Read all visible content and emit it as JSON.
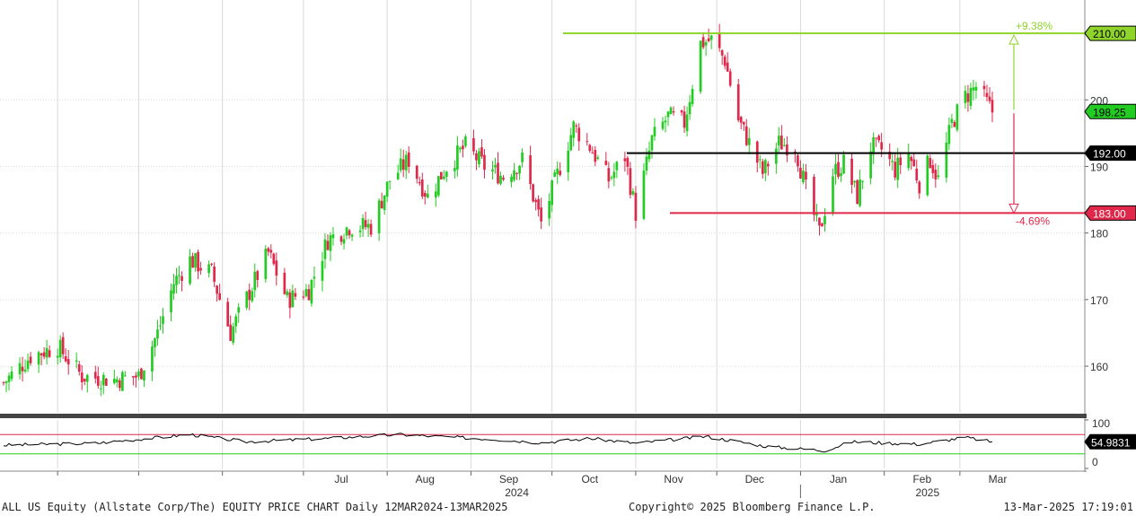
{
  "footer": {
    "left": "ALL US Equity (Allstate Corp/The) EQUITY PRICE CHART  Daily 12MAR2024-13MAR2025",
    "center": "Copyright© 2025 Bloomberg Finance L.P.",
    "right": "13-Mar-2025 17:19:01"
  },
  "colors": {
    "up": "#22cc22",
    "down": "#e0284b",
    "target_up": "#8fd42a",
    "target_down": "#e0284b",
    "support": "#000000",
    "last_price_tag": "#22cc22",
    "grid": "#d9d9d9",
    "rsi_line": "#000000",
    "rsi_upper": "#e0284b",
    "rsi_lower": "#22cc22"
  },
  "chart_data": [
    {
      "type": "candlestick",
      "title": "",
      "ylim": [
        153,
        215
      ],
      "y_ticks": [
        160,
        170,
        180,
        190,
        200
      ],
      "x_month_labels": [
        "Jul",
        "Aug",
        "Sep",
        "Oct",
        "Nov",
        "Dec",
        "Jan",
        "Feb",
        "Mar"
      ],
      "x_year_labels": [
        "2024",
        "2025"
      ],
      "horizontal_lines": [
        {
          "name": "target_high",
          "value": 210.0,
          "label": "210.00"
        },
        {
          "name": "support",
          "value": 192.0,
          "label": "192.00"
        },
        {
          "name": "target_low",
          "value": 183.0,
          "label": "183.00"
        }
      ],
      "last_price": {
        "value": 198.25,
        "label": "198.25"
      },
      "annotations": [
        {
          "text": "+9.38%",
          "value": 210.0
        },
        {
          "text": "-4.69%",
          "value": 183.0
        }
      ],
      "price_path": [
        [
          "2024-03-12",
          157.5
        ],
        [
          "2024-03-22",
          161.5
        ],
        [
          "2024-04-01",
          163.0
        ],
        [
          "2024-04-10",
          158.5
        ],
        [
          "2024-04-22",
          158.0
        ],
        [
          "2024-05-01",
          158.5
        ],
        [
          "2024-05-08",
          165.0
        ],
        [
          "2024-05-14",
          172.5
        ],
        [
          "2024-05-20",
          176.0
        ],
        [
          "2024-05-28",
          174.0
        ],
        [
          "2024-06-04",
          165.0
        ],
        [
          "2024-06-12",
          172.0
        ],
        [
          "2024-06-18",
          177.0
        ],
        [
          "2024-06-25",
          170.0
        ],
        [
          "2024-07-03",
          171.5
        ],
        [
          "2024-07-10",
          179.0
        ],
        [
          "2024-07-18",
          181.0
        ],
        [
          "2024-07-26",
          181.0
        ],
        [
          "2024-08-02",
          188.0
        ],
        [
          "2024-08-09",
          191.0
        ],
        [
          "2024-08-16",
          185.5
        ],
        [
          "2024-08-23",
          190.0
        ],
        [
          "2024-08-30",
          193.0
        ],
        [
          "2024-09-06",
          190.0
        ],
        [
          "2024-09-13",
          188.5
        ],
        [
          "2024-09-20",
          191.0
        ],
        [
          "2024-09-27",
          181.5
        ],
        [
          "2024-10-04",
          190.0
        ],
        [
          "2024-10-09",
          196.0
        ],
        [
          "2024-10-15",
          193.0
        ],
        [
          "2024-10-22",
          188.0
        ],
        [
          "2024-10-28",
          191.5
        ],
        [
          "2024-11-01",
          183.0
        ],
        [
          "2024-11-07",
          194.0
        ],
        [
          "2024-11-13",
          197.5
        ],
        [
          "2024-11-19",
          196.5
        ],
        [
          "2024-11-25",
          208.5
        ],
        [
          "2024-11-29",
          209.0
        ],
        [
          "2024-12-04",
          206.0
        ],
        [
          "2024-12-09",
          197.0
        ],
        [
          "2024-12-13",
          193.5
        ],
        [
          "2024-12-18",
          189.0
        ],
        [
          "2024-12-24",
          193.5
        ],
        [
          "2024-12-30",
          193.0
        ],
        [
          "2025-01-03",
          186.5
        ],
        [
          "2025-01-08",
          180.0
        ],
        [
          "2025-01-13",
          189.0
        ],
        [
          "2025-01-17",
          190.5
        ],
        [
          "2025-01-22",
          185.5
        ],
        [
          "2025-01-27",
          193.0
        ],
        [
          "2025-01-31",
          192.5
        ],
        [
          "2025-02-05",
          189.5
        ],
        [
          "2025-02-10",
          192.0
        ],
        [
          "2025-02-14",
          187.5
        ],
        [
          "2025-02-18",
          191.0
        ],
        [
          "2025-02-21",
          188.0
        ],
        [
          "2025-02-26",
          196.5
        ],
        [
          "2025-03-03",
          200.5
        ],
        [
          "2025-03-07",
          202.0
        ],
        [
          "2025-03-13",
          198.25
        ]
      ]
    },
    {
      "type": "line",
      "title": "RSI",
      "ylim": [
        0,
        100
      ],
      "y_ticks": [
        0,
        100
      ],
      "horizontal_lines": [
        {
          "name": "upper",
          "value": 70
        },
        {
          "name": "lower",
          "value": 30
        }
      ],
      "last_value": {
        "value": 54.9831,
        "label": "54.9831"
      },
      "path": [
        [
          "2024-03-12",
          48
        ],
        [
          "2024-04-15",
          52
        ],
        [
          "2024-05-20",
          70
        ],
        [
          "2024-06-10",
          55
        ],
        [
          "2024-07-10",
          62
        ],
        [
          "2024-08-05",
          70
        ],
        [
          "2024-08-20",
          66
        ],
        [
          "2024-09-10",
          60
        ],
        [
          "2024-09-27",
          53
        ],
        [
          "2024-10-15",
          62
        ],
        [
          "2024-11-01",
          52
        ],
        [
          "2024-11-27",
          66
        ],
        [
          "2024-12-20",
          45
        ],
        [
          "2025-01-10",
          37
        ],
        [
          "2025-01-20",
          55
        ],
        [
          "2025-02-14",
          50
        ],
        [
          "2025-03-03",
          64
        ],
        [
          "2025-03-13",
          54.98
        ]
      ]
    }
  ]
}
